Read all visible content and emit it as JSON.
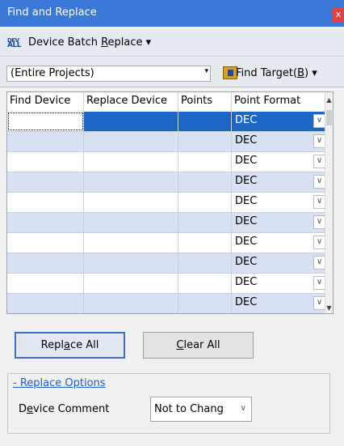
{
  "window": {
    "title": "Find and Replace",
    "close_glyph": "x"
  },
  "toolbar": {
    "batch_icon_top": "DEV",
    "batch_icon_bottom": "ALL",
    "batch_label_pre": "Device Batch ",
    "batch_label_u": "R",
    "batch_label_post": "eplace",
    "dropdown_glyph": "▾"
  },
  "search": {
    "scope_value": "(Entire Projects)",
    "find_target_pre": "Find Target(",
    "find_target_u": "B",
    "find_target_post": ")"
  },
  "grid": {
    "columns": [
      "Find Device",
      "Replace Device",
      "Points",
      "Point Format"
    ],
    "rows": [
      {
        "find": "",
        "replace": "",
        "points": "",
        "format": "DEC"
      },
      {
        "find": "",
        "replace": "",
        "points": "",
        "format": "DEC"
      },
      {
        "find": "",
        "replace": "",
        "points": "",
        "format": "DEC"
      },
      {
        "find": "",
        "replace": "",
        "points": "",
        "format": "DEC"
      },
      {
        "find": "",
        "replace": "",
        "points": "",
        "format": "DEC"
      },
      {
        "find": "",
        "replace": "",
        "points": "",
        "format": "DEC"
      },
      {
        "find": "",
        "replace": "",
        "points": "",
        "format": "DEC"
      },
      {
        "find": "",
        "replace": "",
        "points": "",
        "format": "DEC"
      },
      {
        "find": "",
        "replace": "",
        "points": "",
        "format": "DEC"
      },
      {
        "find": "",
        "replace": "",
        "points": "",
        "format": "DEC"
      }
    ],
    "selected_row": 0,
    "dropdown_glyph": "∨"
  },
  "actions": {
    "replace_all_pre": "Repl",
    "replace_all_u": "a",
    "replace_all_post": "ce All",
    "clear_all_pre": "",
    "clear_all_u": "C",
    "clear_all_post": "lear All"
  },
  "options": {
    "section_title": "- Replace Options",
    "device_comment_pre": "D",
    "device_comment_u": "e",
    "device_comment_post": "vice Comment",
    "device_comment_value": "Not to Chang",
    "select_glyph": "∨"
  },
  "colors": {
    "title_bar": "#3c78d8",
    "selected_row": "#1e66c6",
    "row_light": "#ffffff",
    "row_blue": "#d7e1f3",
    "link": "#1f5fbf"
  }
}
